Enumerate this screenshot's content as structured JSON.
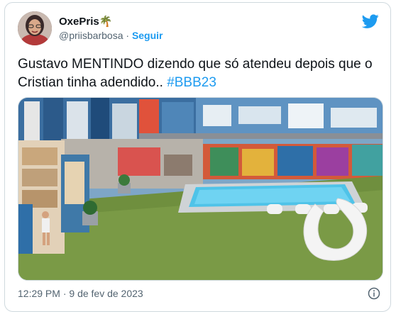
{
  "author": {
    "name": "OxePris",
    "name_emoji": "🌴",
    "handle": "@priisbarbosa",
    "separator": "·",
    "follow_label": "Seguir"
  },
  "tweet": {
    "text_main": "Gustavo MENTINDO dizendo que só atendeu depois que o Cristian tinha adendido.. ",
    "hashtag": "#BBB23"
  },
  "meta": {
    "time": "12:29 PM",
    "separator": "·",
    "date": "9 de fev de 2023"
  },
  "colors": {
    "accent": "#1d9bf0",
    "text": "#0f1419",
    "secondary": "#536471",
    "border": "#cfd9de"
  },
  "icons": {
    "brand": "twitter-bird-icon",
    "info": "info-circle-icon"
  }
}
